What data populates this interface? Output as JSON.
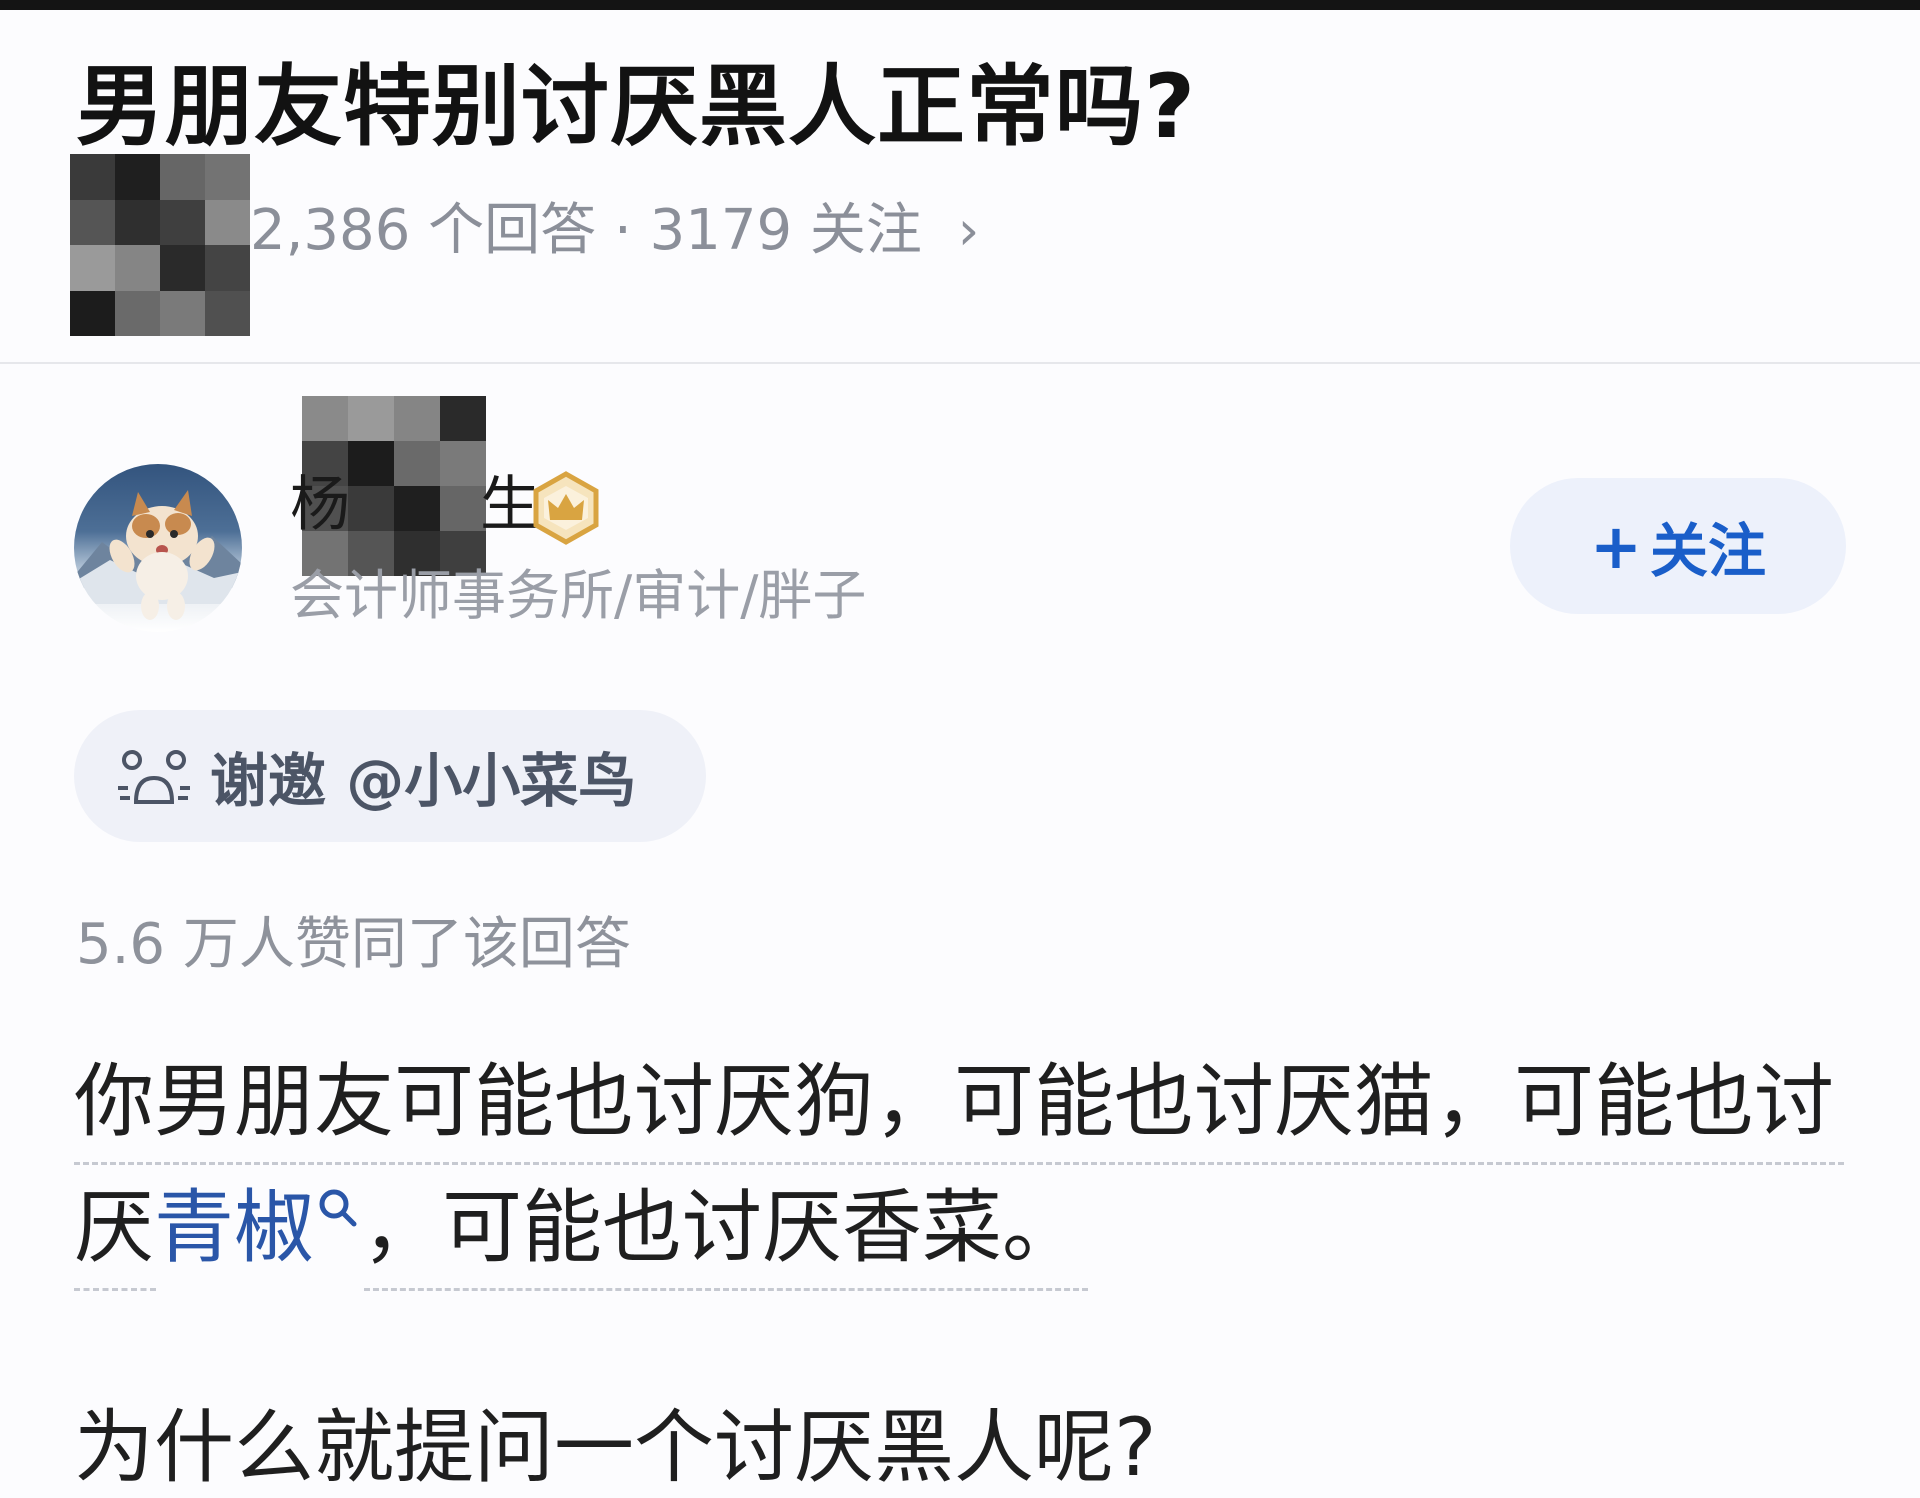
{
  "question": {
    "title": "男朋友特别讨厌黑人正常吗?",
    "answers_count": "2,386 个回答",
    "separator": "·",
    "follows_count": "3179 关注",
    "more_chevron": "›"
  },
  "author": {
    "name_first_char": "杨",
    "name_last_char": "生",
    "bio": "会计师事务所/审计/胖子",
    "badge_icon": "crown-badge-icon",
    "avatar_icon": "cat-avatar-icon"
  },
  "follow_button": {
    "plus": "+",
    "label": "关注"
  },
  "invite": {
    "icon": "invite-people-icon",
    "label": "谢邀 @小小菜鸟"
  },
  "likes_text": "5.6 万人赞同了该回答",
  "answer": {
    "line1": "你男朋友可能也讨厌狗，可能也讨厌猫，可能也讨",
    "line2_pre": "厌",
    "line2_keyword": "青椒",
    "line2_post": "，可能也讨厌香菜。",
    "line3": "为什么就提问一个讨厌黑人呢?"
  },
  "colors": {
    "accent": "#1a5ec9",
    "keyword": "#2a56a8",
    "muted_text": "#8b8f99",
    "follow_bg": "#edf1fb",
    "badge_gold": "#d9a441"
  }
}
